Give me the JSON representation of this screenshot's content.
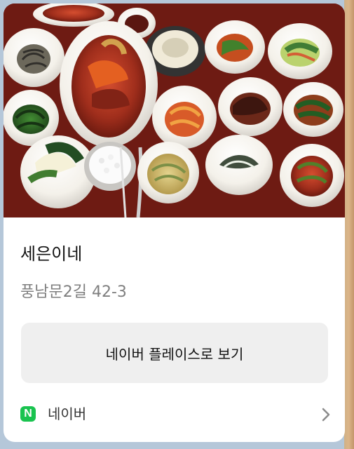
{
  "card": {
    "image_alt": "",
    "title": "세은이네",
    "address": "풍남문2길 42-3",
    "action_label": "네이버 플레이스로 보기",
    "provider_logo_text": "N",
    "provider_name": "네이버"
  },
  "colors": {
    "background": "#b5c7d9",
    "card": "#ffffff",
    "button": "#efefef",
    "naver_green": "#19c34f"
  },
  "icons": {
    "provider": "naver-logo-icon",
    "chevron": "chevron-right-icon"
  }
}
